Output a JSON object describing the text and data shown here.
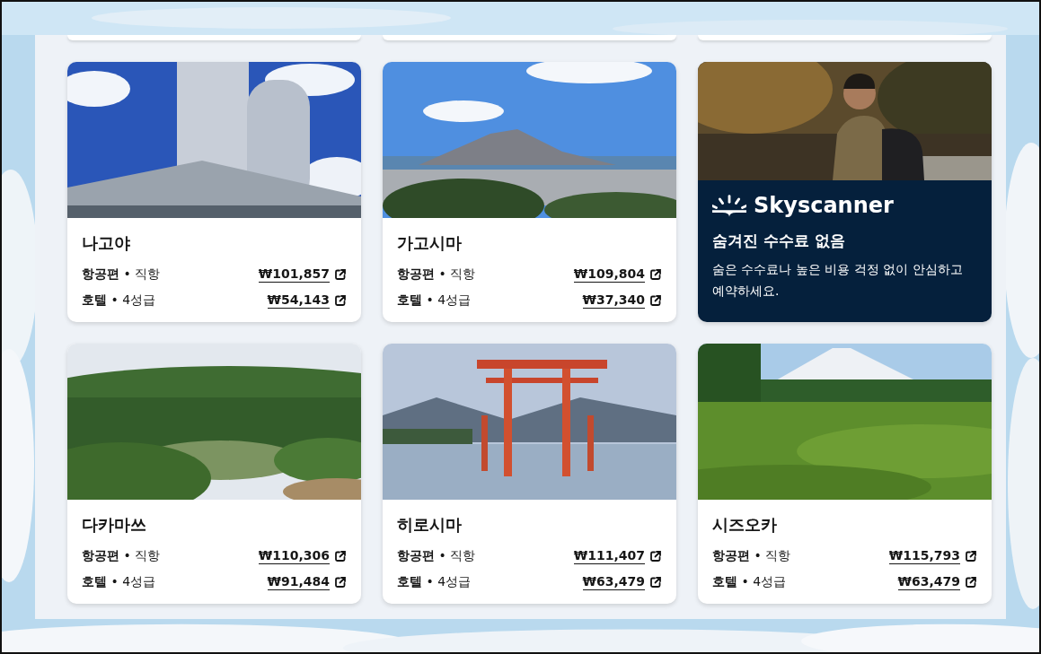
{
  "cards": [
    {
      "kind": "destination",
      "city": "나고야",
      "flight": {
        "label": "항공편",
        "sep": "•",
        "detail": "직항",
        "price": "₩101,857"
      },
      "hotel": {
        "label": "호텔",
        "sep": "•",
        "detail": "4성급",
        "price": "₩54,143"
      }
    },
    {
      "kind": "destination",
      "city": "가고시마",
      "flight": {
        "label": "항공편",
        "sep": "•",
        "detail": "직항",
        "price": "₩109,804"
      },
      "hotel": {
        "label": "호텔",
        "sep": "•",
        "detail": "4성급",
        "price": "₩37,340"
      }
    },
    {
      "kind": "promo",
      "brand": "Skyscanner",
      "title": "숨겨진 수수료 없음",
      "text": "숨은 수수료나 높은 비용 걱정 없이 안심하고 예약하세요."
    },
    {
      "kind": "destination",
      "city": "다카마쓰",
      "flight": {
        "label": "항공편",
        "sep": "•",
        "detail": "직항",
        "price": "₩110,306"
      },
      "hotel": {
        "label": "호텔",
        "sep": "•",
        "detail": "4성급",
        "price": "₩91,484"
      }
    },
    {
      "kind": "destination",
      "city": "히로시마",
      "flight": {
        "label": "항공편",
        "sep": "•",
        "detail": "직항",
        "price": "₩111,407"
      },
      "hotel": {
        "label": "호텔",
        "sep": "•",
        "detail": "4성급",
        "price": "₩63,479"
      }
    },
    {
      "kind": "destination",
      "city": "시즈오카",
      "flight": {
        "label": "항공편",
        "sep": "•",
        "detail": "직항",
        "price": "₩115,793"
      },
      "hotel": {
        "label": "호텔",
        "sep": "•",
        "detail": "4성급",
        "price": "₩63,479"
      }
    }
  ]
}
